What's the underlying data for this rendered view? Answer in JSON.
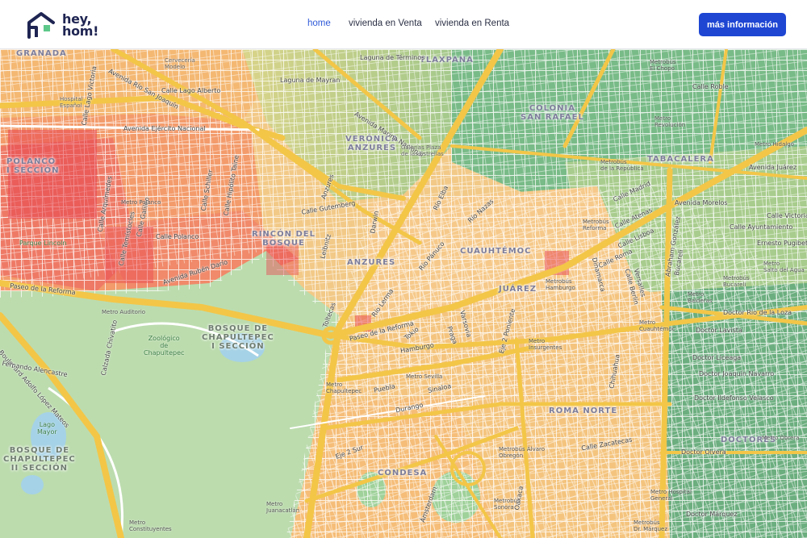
{
  "brand": {
    "line1": "hey,",
    "line2": "hom!",
    "icon": "house-logo-icon"
  },
  "nav": [
    {
      "label": "home",
      "active": true
    },
    {
      "label": "vivienda en Venta",
      "active": false
    },
    {
      "label": "vivienda en Renta",
      "active": false
    }
  ],
  "cta": {
    "label": "más información"
  },
  "colors": {
    "accent": "#1e46d3",
    "nav_active": "#2f5ad8",
    "high_price": "#e8464f",
    "mid_price": "#f6b06a",
    "low_price": "#4fa877",
    "road": "#f3c648",
    "park": "#bfdcae"
  },
  "map": {
    "areas": {
      "granada": "GRANADA",
      "polanco": "POLANCO\nI SECCIÓN",
      "rincon": "RINCÓN DEL\nBOSQUE",
      "veronica": "VERÓNICA\nANZURES",
      "anzures": "ANZURES",
      "tlaxpana": "TLAXPANA",
      "colonia_san_rafael": "COLONIA\nSAN RAFAEL",
      "tabacalera": "TABACALERA",
      "cuauhtemoc": "CUAUHTÉMOC",
      "juarez": "JUÁREZ",
      "roma_norte": "ROMA NORTE",
      "doctores": "DOCTORES",
      "condesa": "CONDESA",
      "bosque1": "BOSQUE DE\nCHAPULTEPEC\nI SECCIÓN",
      "bosque2": "BOSQUE DE\nCHAPULTEPEC\nII SECCIÓN"
    },
    "streets": {
      "laguna_terminos": "Laguna de Términos",
      "laguna_mayran": "Laguna de Mayran",
      "calle_lago_alberto": "Calle Lago Alberto",
      "avenida_ejercito": "Avenida Ejército Nacional",
      "avenida_marina": "Avenida Marina Nacional",
      "gutemberg": "Calle Gutemberg",
      "calle_polanco": "Calle Polanco",
      "avenida_dario": "Avenida Rubén Darío",
      "paseo_reforma_w": "Paseo de la Reforma",
      "paseo_reforma_c": "Paseo de la Reforma",
      "boulevard_lopez_mateos": "Boulevard Adolfo López Mateos",
      "fernando_alencastre": "Fernando Alencastre",
      "calzada_chivatito": "Calzada Chivatito",
      "rio_panuco": "Río Pánuco",
      "rio_nazas": "Río Nazas",
      "rio_lerma": "Río Lerma",
      "rio_elba": "Río Elba",
      "calle_roma": "Calle Roma",
      "calle_berlin": "Calle Berlín",
      "calle_dinamarca": "Dinamarca",
      "calle_versalles": "Versalles",
      "abraham_gonzalez": "Abraham González",
      "bucareli": "Bucareli",
      "calle_hamburgo": "Hamburgo",
      "calle_varsovia": "Varsovia",
      "calle_durango": "Durango",
      "calle_sinaloa": "Sinaloa",
      "calle_puebla": "Puebla",
      "calle_tokio": "Tokio",
      "calle_praga": "Praga",
      "eje2_poniente": "Eje 2 Poniente",
      "eje2_sur": "Eje 2 Sur",
      "calle_zacatecas": "Calle Zacatecas",
      "doctor_rio_loza": "Doctor Río de la Loza",
      "doctor_lavista": "Doctor Lavista",
      "doctor_liceaga": "Doctor Liceaga",
      "doctor_navarro": "Doctor Joaquín Navarro",
      "doctor_velasco": "Doctor Ildefonso Velasco",
      "doctor_olvera": "Doctor Olvera",
      "doctor_marquez": "Doctor Márquez",
      "avenida_juarez": "Avenida Juárez",
      "avenida_morelos": "Avenida Morelos",
      "calle_victoria": "Calle Victoria",
      "calle_ayuntamiento": "Calle Ayuntamiento",
      "ernesto_pugibet": "Ernesto Pugibet",
      "calle_atenas": "Calle Atenas",
      "calle_madrid": "Calle Madrid",
      "calle_lisboa": "Calle Lisboa",
      "calle_roble": "Calle Roble",
      "avenida_rio_san_joaquin": "Avenida Río San Joaquín",
      "calle_lago_victoria": "Calle Lago Victoria",
      "calle_arquimedes": "Calle Arquímedes",
      "avenida_anzures": "Anzures",
      "calle_leibnitz": "Leibnitz",
      "calle_darwin": "Darwin",
      "calle_toltecas": "Toltecas",
      "calle_shiller": "Calle Schiller",
      "calle_hipolito": "Calle Hipólito Taine",
      "calle_galileo": "Calle Galileo",
      "calle_temistocles": "Calle Temístocles",
      "calle_oaxaca": "Oaxaca",
      "calle_amsterdam": "Ámsterdam",
      "calle_chihuahua": "Chihuahua"
    },
    "pois": {
      "cerveceria": "Cervecería\nModelo",
      "hospital": "Hospital\nEspañol",
      "parque_lincoln": "Parque Lincoln",
      "zoologico": "Zoológico\nde\nChapultepec",
      "lago_mayor": "Lago\nMayor",
      "galerias": "Galerías Plaza\nde las Estrellas"
    },
    "metro": {
      "polanco": "Metro Polanco",
      "auditorio": "Metro Auditorio",
      "chapultepec": "Metro\nChapultepec",
      "sevilla": "Metro Sevilla",
      "insurgentes": "Metro\nInsurgentes",
      "hamburgo": "Metrobús\nHamburgo",
      "reforma": "Metrobús\nReforma",
      "republica": "Metrobús\nde la República",
      "revolucion": "Metro\nRevolución",
      "hidalgo": "Metro Hidalgo",
      "el_chopo": "Metrobús\nEl Chopo",
      "cuauhtemoc": "Metro\nCuauhtémoc",
      "obrera": "Metro Obrera",
      "alvaro_obregon": "Metrobús Álvaro\nObregón",
      "sonora": "Metrobús\nSonora",
      "juanacatlan": "Metro\nJuanacatlán",
      "hospital_general": "Metro Hospital\nGeneral",
      "doctor_marquez": "Metrobús\nDr. Márquez",
      "constituyentes": "Metro\nConstituyentes",
      "salto_del_agua": "Metro\nSalto del Agua",
      "bucareli": "Metrobús\nBucareli",
      "balderas": "Metro\nBalderas"
    }
  }
}
